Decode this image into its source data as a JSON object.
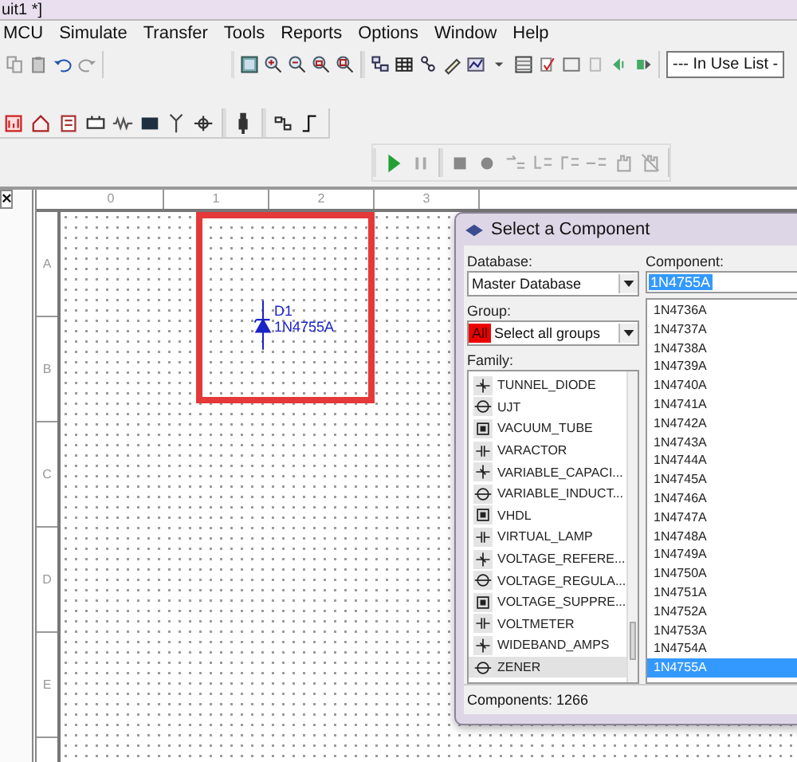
{
  "window": {
    "title": "uit1 *]"
  },
  "menu": [
    "MCU",
    "Simulate",
    "Transfer",
    "Tools",
    "Reports",
    "Options",
    "Window",
    "Help"
  ],
  "in_use_list": {
    "value": "--- In Use List -"
  },
  "panel_close": "×",
  "schematic": {
    "column_labels": [
      "0",
      "1",
      "2",
      "3"
    ],
    "row_labels": [
      "A",
      "B",
      "C",
      "D",
      "E"
    ],
    "component": {
      "ref": "D1",
      "value": "1N4755A"
    }
  },
  "dialog": {
    "title": "Select a Component",
    "database_label": "Database:",
    "database": "Master Database",
    "group_label": "Group:",
    "group_badge": "All",
    "group": "Select all groups",
    "family_label": "Family:",
    "families": [
      {
        "label": "TUNNEL_DIODE",
        "selected": false
      },
      {
        "label": "UJT",
        "selected": false
      },
      {
        "label": "VACUUM_TUBE",
        "selected": false
      },
      {
        "label": "VARACTOR",
        "selected": false
      },
      {
        "label": "VARIABLE_CAPACI...",
        "selected": false
      },
      {
        "label": "VARIABLE_INDUCT...",
        "selected": false
      },
      {
        "label": "VHDL",
        "selected": false
      },
      {
        "label": "VIRTUAL_LAMP",
        "selected": false
      },
      {
        "label": "VOLTAGE_REFERE...",
        "selected": false
      },
      {
        "label": "VOLTAGE_REGULA...",
        "selected": false
      },
      {
        "label": "VOLTAGE_SUPPRE...",
        "selected": false
      },
      {
        "label": "VOLTMETER",
        "selected": false
      },
      {
        "label": "WIDEBAND_AMPS",
        "selected": false
      },
      {
        "label": "ZENER",
        "selected": true
      }
    ],
    "component_label": "Component:",
    "component_value": "1N4755A",
    "components": [
      {
        "label": "1N4736A",
        "selected": false
      },
      {
        "label": "1N4737A",
        "selected": false
      },
      {
        "label": "1N4738A",
        "selected": false
      },
      {
        "label": "1N4739A",
        "selected": false
      },
      {
        "label": "1N4740A",
        "selected": false
      },
      {
        "label": "1N4741A",
        "selected": false
      },
      {
        "label": "1N4742A",
        "selected": false
      },
      {
        "label": "1N4743A",
        "selected": false
      },
      {
        "label": "1N4744A",
        "selected": false
      },
      {
        "label": "1N4745A",
        "selected": false
      },
      {
        "label": "1N4746A",
        "selected": false
      },
      {
        "label": "1N4747A",
        "selected": false
      },
      {
        "label": "1N4748A",
        "selected": false
      },
      {
        "label": "1N4749A",
        "selected": false
      },
      {
        "label": "1N4750A",
        "selected": false
      },
      {
        "label": "1N4751A",
        "selected": false
      },
      {
        "label": "1N4752A",
        "selected": false
      },
      {
        "label": "1N4753A",
        "selected": false
      },
      {
        "label": "1N4754A",
        "selected": false
      },
      {
        "label": "1N4755A",
        "selected": true
      }
    ],
    "count": "Components: 1266"
  }
}
